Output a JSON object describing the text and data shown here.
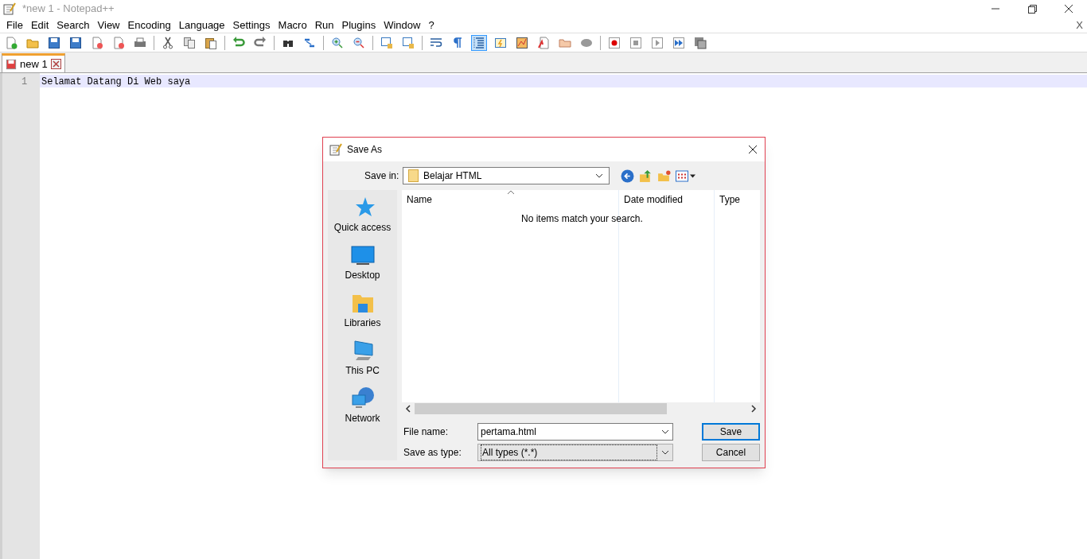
{
  "window": {
    "title": "*new 1 - Notepad++",
    "close_doc": "X"
  },
  "menu": [
    "File",
    "Edit",
    "Search",
    "View",
    "Encoding",
    "Language",
    "Settings",
    "Macro",
    "Run",
    "Plugins",
    "Window",
    "?"
  ],
  "toolbar": [
    {
      "kind": "new",
      "pressed": false
    },
    {
      "kind": "open",
      "pressed": false
    },
    {
      "kind": "save",
      "pressed": false
    },
    {
      "kind": "save",
      "pressed": false
    },
    {
      "kind": "close",
      "pressed": false
    },
    {
      "kind": "close",
      "pressed": false
    },
    {
      "kind": "print",
      "pressed": false
    },
    {
      "kind": "sep"
    },
    {
      "kind": "cut",
      "pressed": false
    },
    {
      "kind": "copy",
      "pressed": false
    },
    {
      "kind": "paste",
      "pressed": false
    },
    {
      "kind": "sep"
    },
    {
      "kind": "undo",
      "pressed": false
    },
    {
      "kind": "redo",
      "pressed": false
    },
    {
      "kind": "sep"
    },
    {
      "kind": "find",
      "pressed": false
    },
    {
      "kind": "replace",
      "pressed": false
    },
    {
      "kind": "sep"
    },
    {
      "kind": "zoom-in",
      "pressed": false
    },
    {
      "kind": "zoom-out",
      "pressed": false
    },
    {
      "kind": "sep"
    },
    {
      "kind": "window",
      "pressed": false
    },
    {
      "kind": "window",
      "pressed": false
    },
    {
      "kind": "sep"
    },
    {
      "kind": "wrap",
      "pressed": false
    },
    {
      "kind": "pilcrow",
      "pressed": false
    },
    {
      "kind": "indent",
      "pressed": true
    },
    {
      "kind": "panel",
      "pressed": false
    },
    {
      "kind": "map",
      "pressed": false
    },
    {
      "kind": "doc",
      "pressed": false
    },
    {
      "kind": "folder",
      "pressed": false
    },
    {
      "kind": "monitor",
      "pressed": false
    },
    {
      "kind": "sep"
    },
    {
      "kind": "record",
      "pressed": false
    },
    {
      "kind": "stop",
      "pressed": false
    },
    {
      "kind": "play",
      "pressed": false
    },
    {
      "kind": "play-multi",
      "pressed": false
    },
    {
      "kind": "save-macro",
      "pressed": false
    }
  ],
  "tabs": [
    {
      "label": "new 1",
      "selected": true,
      "modified": true
    }
  ],
  "editor": {
    "lines": [
      {
        "number": "1",
        "text": "Selamat Datang Di Web saya",
        "current": true
      }
    ]
  },
  "dialog": {
    "title": "Save As",
    "save_in_label": "Save in:",
    "save_in": "Belajar HTML",
    "places": [
      {
        "kind": "star",
        "label": "Quick access"
      },
      {
        "kind": "desktop",
        "label": "Desktop"
      },
      {
        "kind": "libraries",
        "label": "Libraries"
      },
      {
        "kind": "pc",
        "label": "This PC"
      },
      {
        "kind": "network",
        "label": "Network"
      }
    ],
    "columns": [
      "Name",
      "Date modified",
      "Type"
    ],
    "empty_message": "No items match your search.",
    "file_name_label": "File name:",
    "file_name": "pertama.html",
    "save_type_label": "Save as type:",
    "save_type": "All types (*.*)",
    "buttons": [
      {
        "label": "Save",
        "default": true
      },
      {
        "label": "Cancel",
        "default": false
      }
    ]
  }
}
